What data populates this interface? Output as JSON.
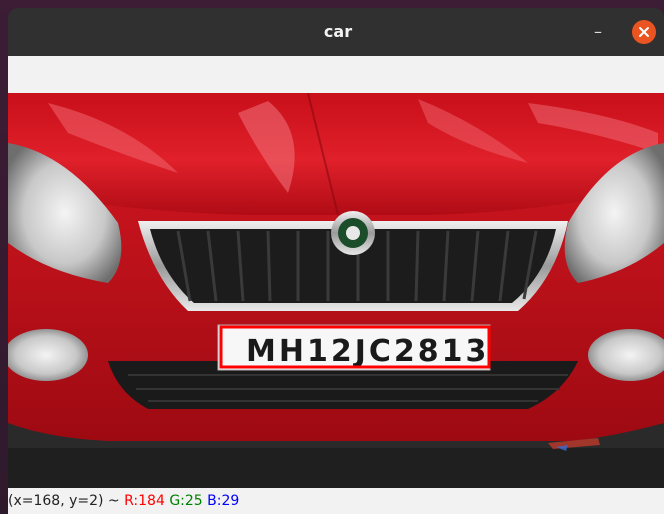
{
  "window": {
    "title": "car",
    "minimize_icon": "minimize-icon",
    "close_icon": "close-icon"
  },
  "image": {
    "plate_text": "MH12JC2813",
    "accent": "#e8001c",
    "box_color": "#ff0000"
  },
  "status": {
    "coords": "(x=168, y=2) ~",
    "r": "R:184",
    "g": "G:25",
    "b": "B:29",
    "r_color": "#ff0000",
    "g_color": "#008000",
    "b_color": "#0000ff"
  }
}
